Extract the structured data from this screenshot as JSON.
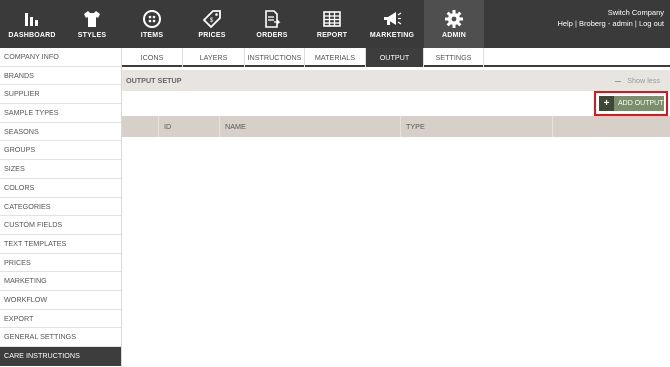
{
  "nav": {
    "items": [
      {
        "label": "DASHBOARD",
        "icon": "dashboard-icon"
      },
      {
        "label": "STYLES",
        "icon": "shirt-icon"
      },
      {
        "label": "ITEMS",
        "icon": "button-icon"
      },
      {
        "label": "PRICES",
        "icon": "price-tag-icon"
      },
      {
        "label": "ORDERS",
        "icon": "orders-icon"
      },
      {
        "label": "REPORT",
        "icon": "report-grid-icon"
      },
      {
        "label": "MARKETING",
        "icon": "megaphone-icon"
      },
      {
        "label": "ADMIN",
        "icon": "gear-icon"
      }
    ],
    "active": "ADMIN"
  },
  "account": {
    "switch_company": "Switch Company",
    "help": "Help",
    "user": "Broberg - admin",
    "logout": "Log out",
    "separator": "|"
  },
  "sidebar": {
    "items": [
      "COMPANY INFO",
      "BRANDS",
      "SUPPLIER",
      "SAMPLE TYPES",
      "SEASONS",
      "GROUPS",
      "SIZES",
      "COLORS",
      "CATEGORIES",
      "CUSTOM FIELDS",
      "TEXT TEMPLATES",
      "PRICES",
      "MARKETING",
      "WORKFLOW",
      "EXPORT",
      "GENERAL SETTINGS",
      "CARE INSTRUCTIONS"
    ],
    "active": "CARE INSTRUCTIONS"
  },
  "tabs": {
    "items": [
      "ICONS",
      "LAYERS",
      "INSTRUCTIONS",
      "MATERIALS",
      "OUTPUT",
      "SETTINGS"
    ],
    "active": "OUTPUT"
  },
  "panel": {
    "title": "OUTPUT SETUP",
    "show_less": "Show less",
    "add_button": "ADD OUTPUT",
    "add_button_icon": "+"
  },
  "table": {
    "columns": [
      "",
      "ID",
      "NAME",
      "TYPE",
      ""
    ]
  },
  "colors": {
    "nav_bg": "#3a3a3a",
    "active_dark": "#3d3d3d",
    "add_button": "#7a8f6a",
    "highlight": "#e0141a"
  }
}
